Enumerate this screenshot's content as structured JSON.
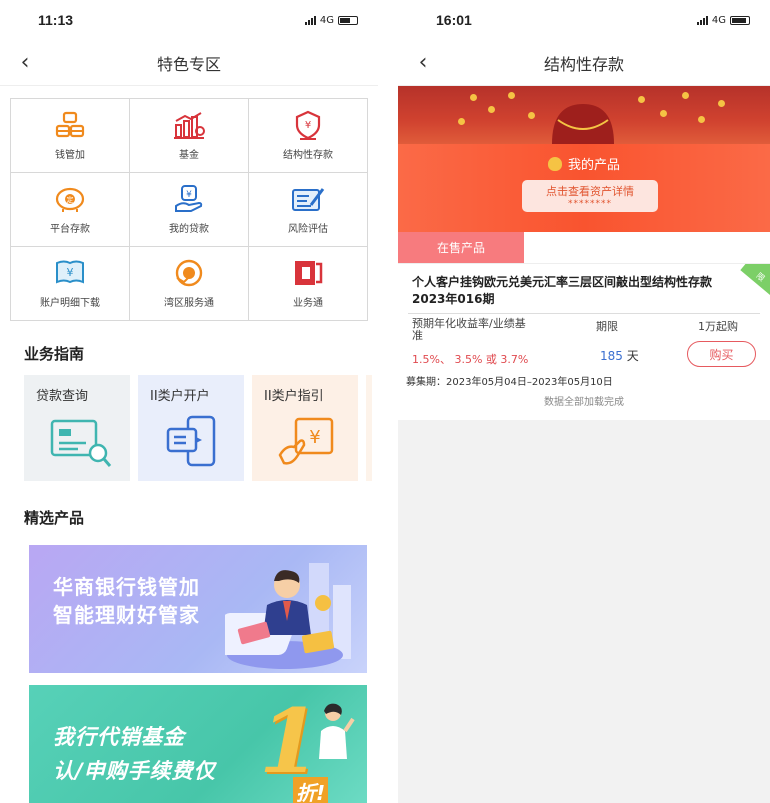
{
  "left": {
    "status": {
      "time": "11:13",
      "network": "4G"
    },
    "nav": {
      "back": "‹",
      "title": "特色专区"
    },
    "grid": [
      {
        "label": "钱管加",
        "icon": "coin-stack-icon"
      },
      {
        "label": "基金",
        "icon": "fund-chart-icon"
      },
      {
        "label": "结构性存款",
        "icon": "yuan-shield-icon"
      },
      {
        "label": "平台存款",
        "icon": "piggy-bank-icon"
      },
      {
        "label": "我的贷款",
        "icon": "loan-hand-icon"
      },
      {
        "label": "风险评估",
        "icon": "assessment-form-icon"
      },
      {
        "label": "账户明细下载",
        "icon": "statement-download-icon"
      },
      {
        "label": "湾区服务通",
        "icon": "bay-area-icon"
      },
      {
        "label": "业务通",
        "icon": "business-door-icon"
      }
    ],
    "guide_title": "业务指南",
    "guide": [
      {
        "label": "贷款查询",
        "icon": "loan-query-icon"
      },
      {
        "label": "II类户开户",
        "icon": "account-open-icon"
      },
      {
        "label": "II类户指引",
        "icon": "account-guide-icon"
      }
    ],
    "products_title": "精选产品",
    "banner1": {
      "line1": "华商银行钱管加",
      "line2": "智能理财好管家"
    },
    "banner2": {
      "line1": "我行代销基金",
      "line2": "认/申购手续费仅",
      "big": "1",
      "suffix": "折!"
    }
  },
  "right": {
    "status": {
      "time": "16:01",
      "network": "4G"
    },
    "nav": {
      "back": "‹",
      "title": "结构性存款"
    },
    "my_products": {
      "title": "我的产品",
      "link": "点击查看资产详情",
      "masked": "********"
    },
    "tab": "在售产品",
    "product": {
      "name": "个人客户挂钩欧元兑美元汇率三层区间敲出型结构性存款2023年016期",
      "corner": "限",
      "col1_header": "预期年化收益率/业绩基准",
      "col2_header": "期限",
      "col3_header": "1万起购",
      "rate1": "1.5%、",
      "rate2": "3.5%",
      "rate_or": " 或 ",
      "rate3": "3.7%",
      "term_value": "185",
      "term_unit": " 天",
      "buy": "购买",
      "period": "募集期：2023年05月04日–2023年05月10日"
    },
    "loaded_text": "数据全部加载完成"
  },
  "colors": {
    "accent_red": "#e65a5f",
    "tab_pink": "#f77b7e",
    "banner_orange": "#f9542f",
    "link_blue": "#3a6fd0"
  }
}
